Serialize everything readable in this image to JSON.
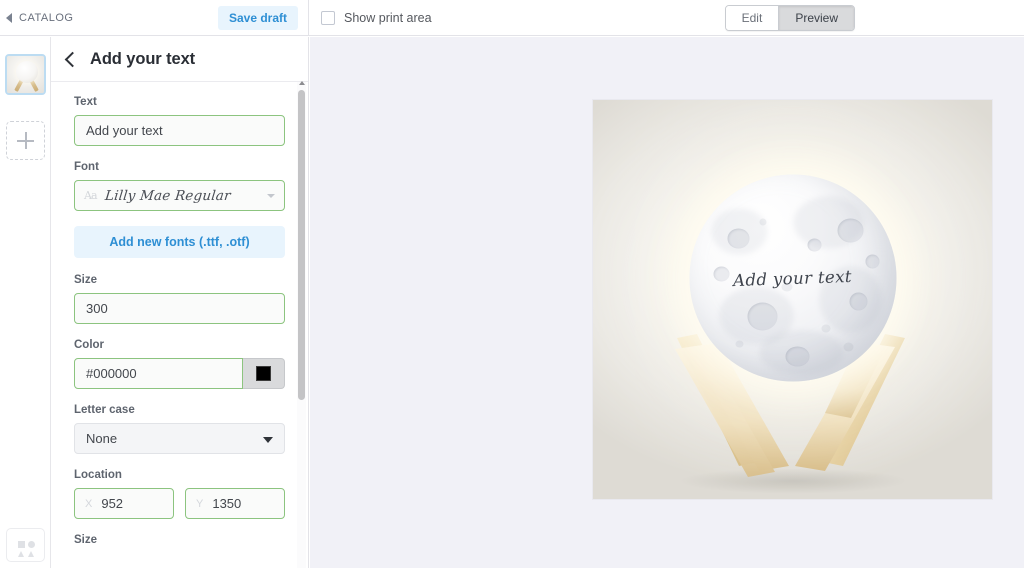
{
  "topbar": {
    "catalog_label": "CATALOG",
    "catalog_icon": "triangle-left-icon",
    "save_draft_label": "Save draft",
    "show_print_area_label": "Show print area",
    "show_print_area_checked": false,
    "view_modes": [
      {
        "label": "Edit",
        "active": false
      },
      {
        "label": "Preview",
        "active": true
      }
    ]
  },
  "rail": {
    "thumbnail_name": "product-thumbnail",
    "add_tile_label": "+",
    "bottom_tile_name": "shapes-icon"
  },
  "panel": {
    "title": "Add your text",
    "back_icon": "chevron-left-icon",
    "fields": {
      "text": {
        "label": "Text",
        "value": "Add your text",
        "placeholder": "Add your text"
      },
      "font": {
        "label": "Font",
        "value": "Lilly Mae Regular",
        "glyph": "Aa"
      },
      "add_fonts_button": "Add new fonts (.ttf, .otf)",
      "size": {
        "label": "Size",
        "value": "300"
      },
      "color": {
        "label": "Color",
        "value": "#000000",
        "swatch_hex": "#000000"
      },
      "letter_case": {
        "label": "Letter case",
        "value": "None"
      },
      "location": {
        "label": "Location",
        "x_prefix": "X",
        "x_value": "952",
        "y_prefix": "Y",
        "y_value": "1350"
      },
      "size_bottom": {
        "label": "Size"
      }
    }
  },
  "canvas": {
    "preview_text": "Add your text",
    "background_hex": "#f1f1f7"
  },
  "colors": {
    "accent_blue": "#2e8fd4",
    "accent_blue_bg": "#e8f4fd",
    "input_border_green": "#8cc47f",
    "canvas_bg": "#f1f1f7"
  }
}
